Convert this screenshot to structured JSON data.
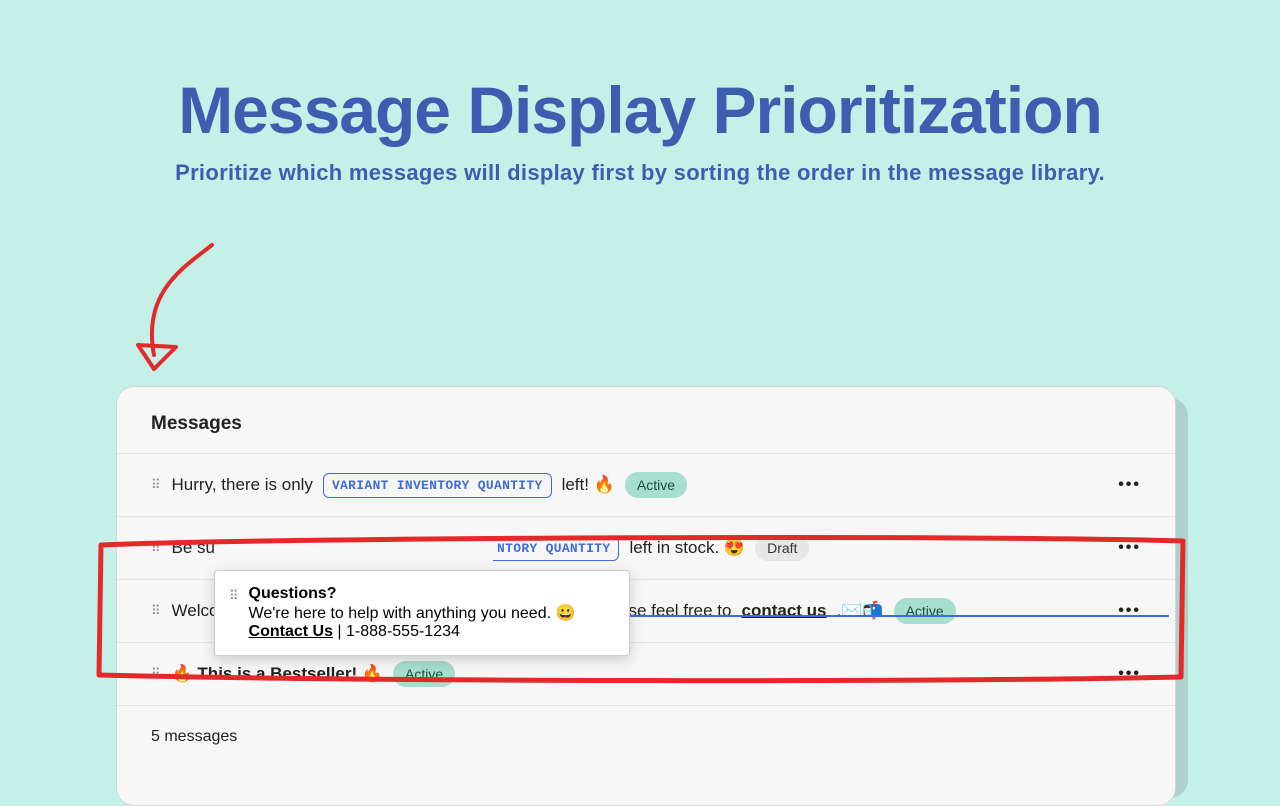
{
  "hero": {
    "title": "Message Display Prioritization",
    "subtitle": "Prioritize which messages will display first by sorting the order in the message library."
  },
  "panel": {
    "header": "Messages",
    "rows": [
      {
        "pre": "Hurry, there is only ",
        "chip": "VARIANT INVENTORY QUANTITY",
        "post": " left! 🔥",
        "badge": "Active",
        "badgeClass": "active"
      },
      {
        "pre": "Be su",
        "chip_partial": "NTORY QUANTITY",
        "post": " left in stock. 😍",
        "badge": "Draft",
        "badgeClass": "draft"
      },
      {
        "pre": "Welco",
        "mid": "se feel free to ",
        "contact": "contact us",
        "post2": ".✉️📬",
        "badge": "Active",
        "badgeClass": "active"
      },
      {
        "bold": "🔥 This is a Bestseller! 🔥",
        "badge": "Active",
        "badgeClass": "active"
      }
    ],
    "footer": "5 messages"
  },
  "drag": {
    "q": "Questions?",
    "help": "We're here to help with anything you need. 😀",
    "cu": "Contact Us",
    "phone": " | 1-888-555-1234"
  }
}
